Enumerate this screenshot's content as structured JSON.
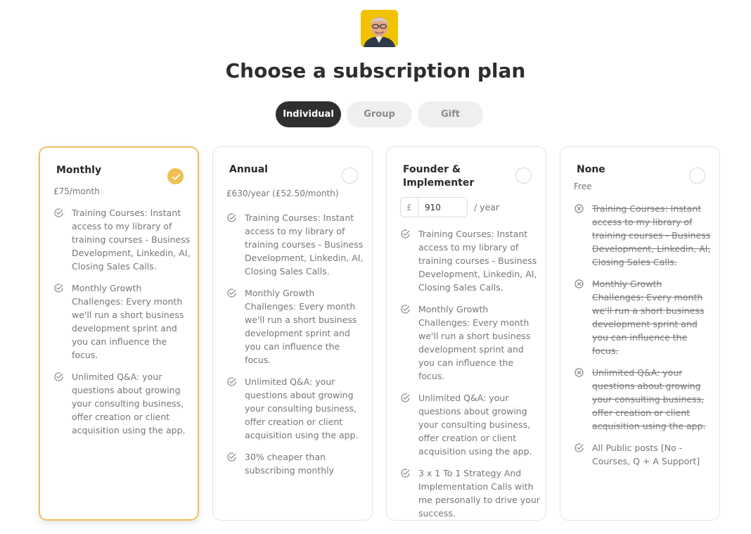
{
  "page": {
    "title": "Choose a subscription plan"
  },
  "tabs": [
    {
      "label": "Individual",
      "active": true
    },
    {
      "label": "Group",
      "active": false
    },
    {
      "label": "Gift",
      "active": false
    }
  ],
  "colors": {
    "accent": "#efbf55",
    "tab_active": "#2f2f2f",
    "muted_text": "#777777"
  },
  "plans": [
    {
      "name": "Monthly",
      "price": "£75/month",
      "selected": true,
      "features": [
        {
          "icon": "check-circle-icon",
          "text": "Training Courses: Instant access to my library of training courses - Business Development, Linkedin, AI, Closing Sales Calls."
        },
        {
          "icon": "check-circle-icon",
          "text": "Monthly Growth Challenges: Every month we'll run a short business development sprint and you can influence the focus."
        },
        {
          "icon": "check-circle-icon",
          "text": "Unlimited Q&A: your questions about growing your consulting business, offer creation or client acquisition using the app."
        }
      ]
    },
    {
      "name": "Annual",
      "price": "£630/year (£52.50/month)",
      "selected": false,
      "features": [
        {
          "icon": "check-circle-icon",
          "text": "Training Courses: Instant access to my library of training courses - Business Development, Linkedin, AI, Closing Sales Calls."
        },
        {
          "icon": "check-circle-icon",
          "text": "Monthly Growth Challenges: Every month we'll run a short business development sprint and you can influence the focus."
        },
        {
          "icon": "check-circle-icon",
          "text": "Unlimited Q&A: your questions about growing your consulting business, offer creation or client acquisition using the app."
        },
        {
          "icon": "check-circle-icon",
          "text": "30% cheaper than subscribing monthly"
        }
      ]
    },
    {
      "name": "Founder & Implementer",
      "currency": "£",
      "amount": "910",
      "per": "/ year",
      "selected": false,
      "features": [
        {
          "icon": "check-circle-icon",
          "text": "Training Courses: Instant access to my library of training courses - Business Development, Linkedin, AI, Closing Sales Calls."
        },
        {
          "icon": "check-circle-icon",
          "text": "Monthly Growth Challenges: Every month we'll run a short business development sprint and you can influence the focus."
        },
        {
          "icon": "check-circle-icon",
          "text": "Unlimited Q&A: your questions about growing your consulting business, offer creation or client acquisition using the app."
        },
        {
          "icon": "check-circle-icon",
          "text": "3 x 1 To 1 Strategy And Implementation Calls with me personally to drive your success."
        }
      ]
    },
    {
      "name": "None",
      "price": "Free",
      "selected": false,
      "features": [
        {
          "icon": "x-circle-icon",
          "text": "Training Courses: Instant access to my library of training courses - Business Development, Linkedin, AI, Closing Sales Calls.",
          "excluded": true
        },
        {
          "icon": "x-circle-icon",
          "text": "Monthly Growth Challenges: Every month we'll run a short business development sprint and you can influence the focus.",
          "excluded": true
        },
        {
          "icon": "x-circle-icon",
          "text": "Unlimited Q&A: your questions about growing your consulting business, offer creation or client acquisition using the app.",
          "excluded": true
        },
        {
          "icon": "check-circle-icon",
          "text": "All Public posts [No - Courses, Q + A Support]"
        }
      ]
    }
  ]
}
